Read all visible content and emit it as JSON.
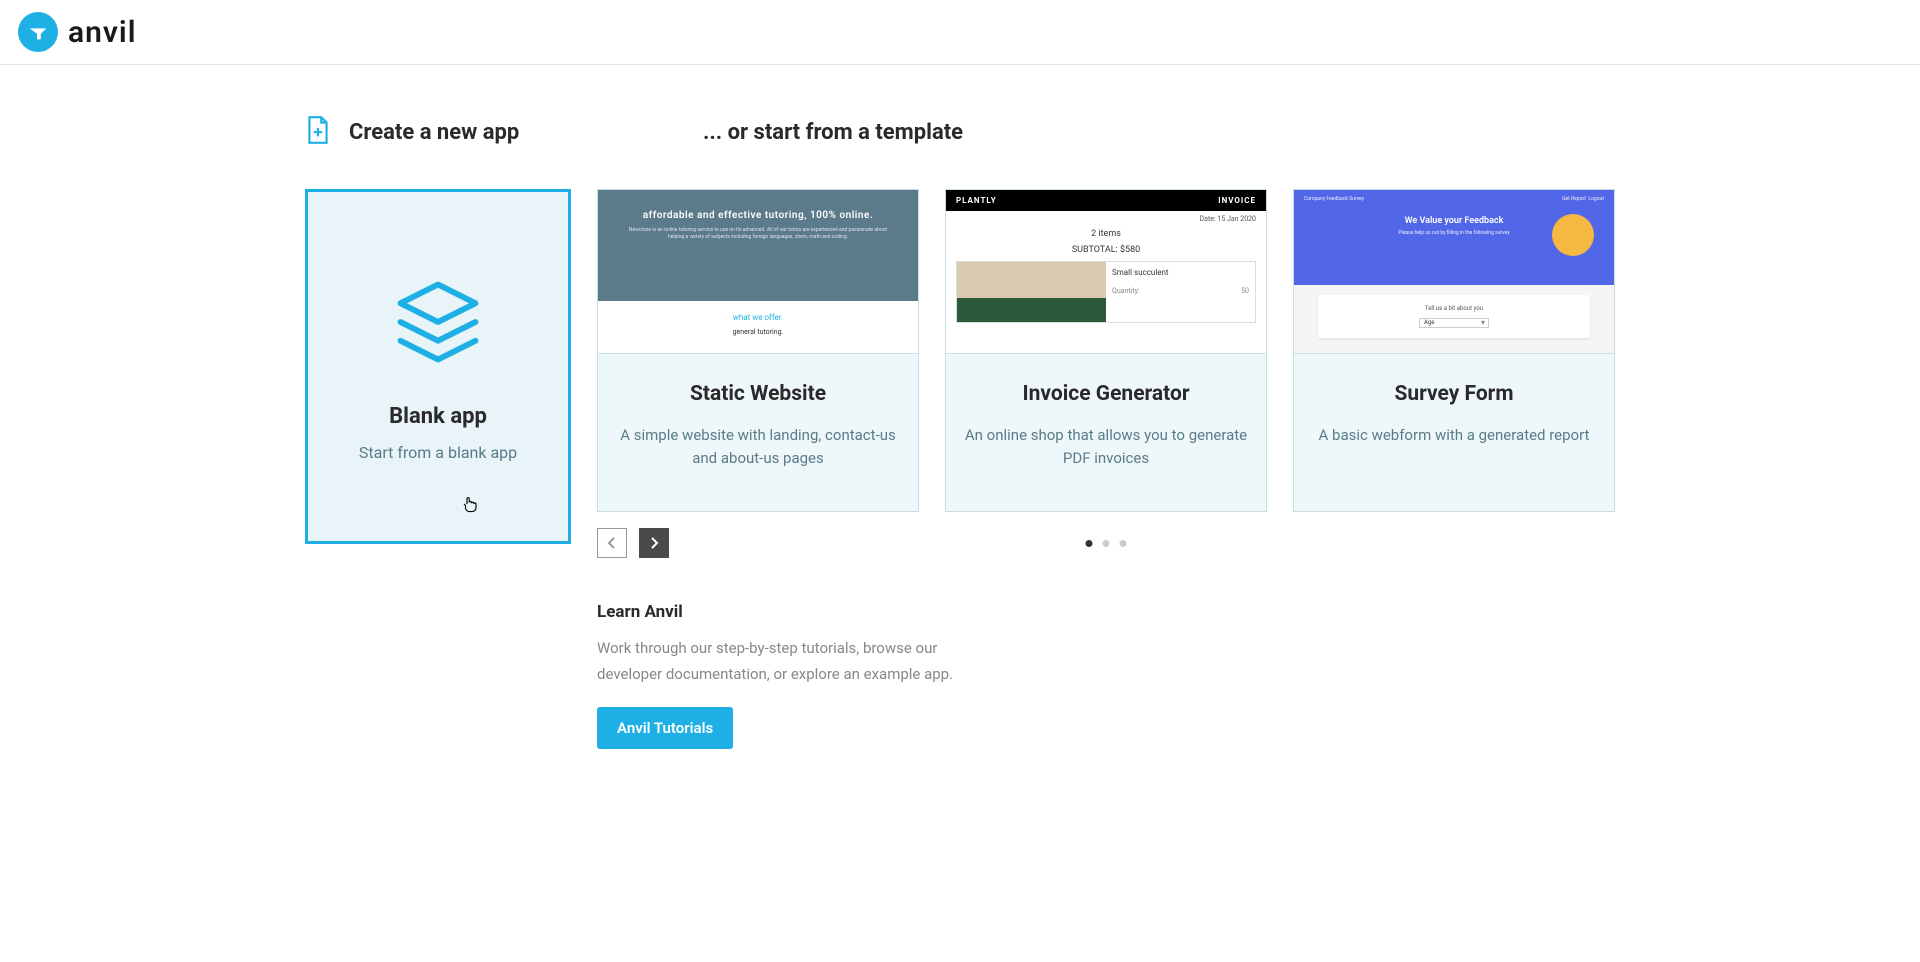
{
  "brand": "anvil",
  "headers": {
    "create": "Create a new app",
    "template": "... or start from a template"
  },
  "blank": {
    "title": "Blank app",
    "subtitle": "Start from a blank app"
  },
  "templates": [
    {
      "title": "Static Website",
      "desc": "A simple website with landing, contact-us and about-us pages",
      "preview": {
        "type": "static",
        "headline": "affordable and effective tutoring, 100% online.",
        "blurb": "Newclone is an online tutoring service to use on its advanced. All of our tutors are experienced and passionate about helping a variety of subjects including foreign languages, chem, math and coding.",
        "section": "what we offer.",
        "section_sub": "general tutoring."
      }
    },
    {
      "title": "Invoice Generator",
      "desc": "An online shop that allows you to generate PDF invoices",
      "preview": {
        "type": "invoice",
        "brand": "PLANTLY",
        "label": "INVOICE",
        "date": "Date: 15 Jan 2020",
        "items_line": "2 items",
        "subtotal": "SUBTOTAL: $580",
        "product": "Small succulent",
        "qty_label": "Quantity:",
        "qty": "50"
      }
    },
    {
      "title": "Survey Form",
      "desc": "A basic webform with a generated report",
      "preview": {
        "type": "survey",
        "topbar_left": "Company Feedback Survey",
        "topbar_right1": "Get Report",
        "topbar_right2": "Logout",
        "headline": "We Value your Feedback",
        "sub": "Please help us out by filling in the following survey",
        "card_label": "Tell us a bit about you",
        "select": "Age"
      }
    }
  ],
  "carousel": {
    "active_dot": 0,
    "total_dots": 3
  },
  "learn": {
    "title": "Learn Anvil",
    "desc": "Work through our step-by-step tutorials, browse our developer documentation, or explore an example app.",
    "button": "Anvil Tutorials"
  }
}
